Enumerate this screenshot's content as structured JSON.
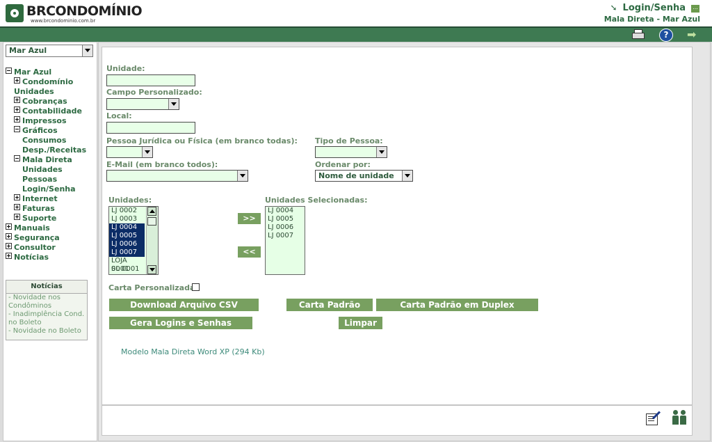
{
  "header": {
    "logo_text": "BRCONDOMÍNIO",
    "logo_sub": "www.brcondominio.com.br",
    "login_link": "Login/Senha",
    "login_more": "...",
    "breadcrumb": "Mala Direta - Mar Azul"
  },
  "toolbar": {
    "icons": [
      "printer-icon",
      "help-icon",
      "exit-icon"
    ],
    "help_glyph": "?",
    "exit_glyph": "➡"
  },
  "sidebar": {
    "condo_select": "Mar Azul",
    "tree": [
      {
        "label": "Mar Azul",
        "toggle": "minus",
        "level": 0
      },
      {
        "label": "Condomínio",
        "toggle": "plus",
        "level": 1
      },
      {
        "label": "Unidades",
        "toggle": "none",
        "level": 1
      },
      {
        "label": "Cobranças",
        "toggle": "plus",
        "level": 1
      },
      {
        "label": "Contabilidade",
        "toggle": "plus",
        "level": 1
      },
      {
        "label": "Impressos",
        "toggle": "plus",
        "level": 1
      },
      {
        "label": "Gráficos",
        "toggle": "minus",
        "level": 1
      },
      {
        "label": "Consumos",
        "toggle": "none",
        "level": 2
      },
      {
        "label": "Desp./Receitas",
        "toggle": "none",
        "level": 2
      },
      {
        "label": "Mala Direta",
        "toggle": "minus",
        "level": 1
      },
      {
        "label": "Unidades",
        "toggle": "none",
        "level": 2
      },
      {
        "label": "Pessoas",
        "toggle": "none",
        "level": 2
      },
      {
        "label": "Login/Senha",
        "toggle": "none",
        "level": 2
      },
      {
        "label": "Internet",
        "toggle": "plus",
        "level": 1
      },
      {
        "label": "Faturas",
        "toggle": "plus",
        "level": 1
      },
      {
        "label": "Suporte",
        "toggle": "plus",
        "level": 1
      },
      {
        "label": "Manuais",
        "toggle": "plus",
        "level": 0
      },
      {
        "label": "Segurança",
        "toggle": "plus",
        "level": 0
      },
      {
        "label": "Consultor",
        "toggle": "plus",
        "level": 0
      },
      {
        "label": "Notícias",
        "toggle": "plus",
        "level": 0
      }
    ],
    "news": {
      "title": "Notícias",
      "items": [
        "- Novidade nos",
        "Condôminos",
        "- Inadimplência Cond.",
        "no Boleto",
        "- Novidade no Boleto"
      ]
    }
  },
  "form": {
    "unidade_label": "Unidade:",
    "unidade_value": "",
    "campo_label": "Campo Personalizado:",
    "campo_value": "",
    "local_label": "Local:",
    "local_value": "",
    "pessoa_label": "Pessoa Jurídica ou Física (em branco todas):",
    "pessoa_value": "",
    "tipo_label": "Tipo de Pessoa:",
    "tipo_value": "",
    "email_label": "E-Mail (em branco todos):",
    "email_value": "",
    "ordenar_label": "Ordenar por:",
    "ordenar_value": "Nome de unidade",
    "unidades_label": "Unidades:",
    "unidades_options": [
      {
        "text": "LJ 0002",
        "selected": false
      },
      {
        "text": "LJ 0003",
        "selected": false
      },
      {
        "text": "LJ 0004",
        "selected": true
      },
      {
        "text": "LJ 0005",
        "selected": true
      },
      {
        "text": "LJ 0006",
        "selected": true
      },
      {
        "text": "LJ 0007",
        "selected": true
      },
      {
        "text": "LOJA 0001",
        "selected": false
      },
      {
        "text": "SL 0001",
        "selected": false
      }
    ],
    "selecionadas_label": "Unidades Selecionadas:",
    "selecionadas_options": [
      "LJ 0004",
      "LJ 0005",
      "LJ 0006",
      "LJ 0007"
    ],
    "add_button": ">>",
    "remove_button": "<<",
    "carta_label": "Carta Personalizada:",
    "carta_checked": false
  },
  "actions": {
    "download_csv": "Download Arquivo CSV",
    "carta_padrao": "Carta Padrão",
    "carta_duplex": "Carta Padrão em Duplex",
    "gera_logins": "Gera Logins e Senhas",
    "limpar": "Limpar"
  },
  "links": {
    "modelo": "Modelo Mala Direta Word XP (294 Kb)"
  },
  "footer_icons": [
    "edit-icon",
    "people-icon"
  ]
}
